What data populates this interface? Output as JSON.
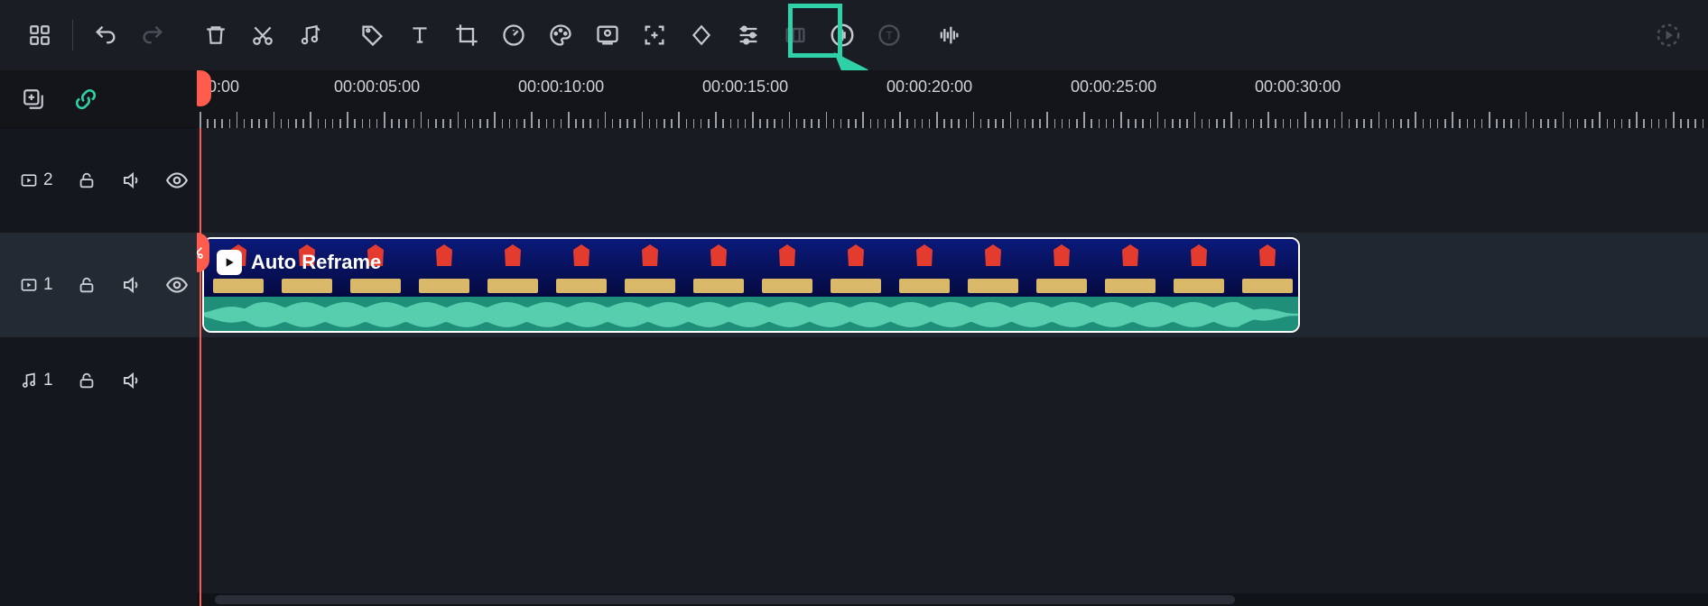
{
  "toolbar": {
    "icons": [
      {
        "name": "apps-icon",
        "interact": true
      },
      {
        "name": "divider"
      },
      {
        "name": "undo-icon",
        "interact": true
      },
      {
        "name": "redo-icon",
        "interact": true,
        "disabled": true
      },
      {
        "name": "delete-icon",
        "interact": true
      },
      {
        "name": "cut-icon",
        "interact": true
      },
      {
        "name": "music-icon",
        "interact": true
      },
      {
        "name": "tag-icon",
        "interact": true
      },
      {
        "name": "text-icon",
        "interact": true
      },
      {
        "name": "crop-icon",
        "interact": true
      },
      {
        "name": "speed-icon",
        "interact": true
      },
      {
        "name": "color-icon",
        "interact": true
      },
      {
        "name": "pip-icon",
        "interact": true
      },
      {
        "name": "focus-icon",
        "interact": true
      },
      {
        "name": "keyframe-icon",
        "interact": true
      },
      {
        "name": "adjust-icon",
        "interact": true
      },
      {
        "name": "frame-icon",
        "interact": true,
        "disabled": true
      },
      {
        "name": "audio-sync-icon",
        "interact": true,
        "highlighted": true
      },
      {
        "name": "caption-icon",
        "interact": true,
        "disabled": true
      },
      {
        "name": "beat-icon",
        "interact": true
      }
    ],
    "right_icon": "render-icon"
  },
  "left_header": {
    "add_track": "add-track-icon",
    "link": "link-icon"
  },
  "tracks": [
    {
      "id": "v2",
      "type": "video",
      "label": "2",
      "controls": [
        "lock",
        "mute",
        "visibility"
      ]
    },
    {
      "id": "v1",
      "type": "video",
      "label": "1",
      "controls": [
        "lock",
        "mute",
        "visibility"
      ]
    },
    {
      "id": "a1",
      "type": "audio",
      "label": "1",
      "controls": [
        "lock",
        "mute"
      ]
    }
  ],
  "ruler": {
    "labels": [
      "00:00",
      "00:00:05:00",
      "00:00:10:00",
      "00:00:15:00",
      "00:00:20:00",
      "00:00:25:00",
      "00:00:30:00"
    ]
  },
  "clip": {
    "title": "Auto Reframe"
  },
  "colors": {
    "accent": "#2fd1a8",
    "playhead": "#ff5c4d"
  }
}
